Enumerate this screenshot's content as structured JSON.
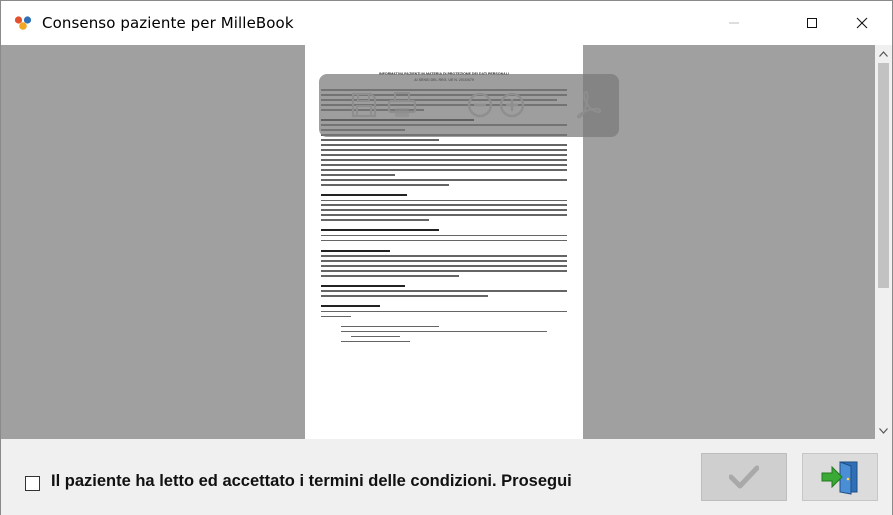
{
  "window": {
    "title": "Consenso paziente per MilleBook"
  },
  "document": {
    "heading_line1": "INFORMATIVA PAZIENTI IN MATERIA DI PROTEZIONE DEI DATI PERSONALI",
    "heading_line2": "AI SENSI DEL REG. UE N. 2016/679"
  },
  "footer": {
    "consent_label": "Il paziente ha letto ed accettato i termini delle condizioni. Prosegui"
  },
  "icons": {
    "app": "millebook-logo-icon",
    "save": "save-icon",
    "print": "print-icon",
    "zoom_out": "zoom-out-icon",
    "zoom_in": "zoom-in-icon",
    "pdf": "acrobat-pdf-icon",
    "confirm": "checkmark-icon",
    "exit": "exit-door-icon"
  },
  "colors": {
    "viewer_background": "#a0a0a0",
    "confirm_disabled": "#cfcfcf",
    "exit_green": "#3aa935",
    "door_blue": "#2f6fb5"
  }
}
